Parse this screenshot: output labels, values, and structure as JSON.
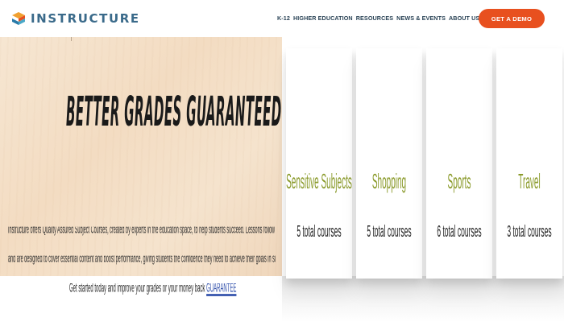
{
  "header": {
    "logo_text": "INSTRUCTURE",
    "nav": [
      "K-12",
      "HIGHER EDUCATION",
      "RESOURCES",
      "NEWS & EVENTS",
      "ABOUT US"
    ],
    "cta_label": "GET A DEMO"
  },
  "hero": {
    "headline": "BETTER GRADES GUARANTEED",
    "paragraph_line1": "Instructure offers Quality Assured Subject Courses, created by experts in the education space, to help students succeed. Lessons follow the curriculum guidelines",
    "paragraph_line2": "and are designed to cover essential content and boost performance, giving students the confidence they need to achieve their goals in subjects and skills they value.",
    "paragraph_line3_prefix": "Get started today and improve your grades or your money back ",
    "paragraph_link": "GUARANTEE"
  },
  "cards": [
    {
      "title": "Sensitive Subjects",
      "subtitle": "5 total courses"
    },
    {
      "title": "Shopping",
      "subtitle": "5 total courses"
    },
    {
      "title": "Sports",
      "subtitle": "6 total courses"
    },
    {
      "title": "Travel",
      "subtitle": "3 total courses"
    }
  ],
  "colors": {
    "brand": "#3a6a8a",
    "cta": "#e8501f",
    "card_title": "#8a9a2a",
    "link": "#2a4aa8"
  }
}
